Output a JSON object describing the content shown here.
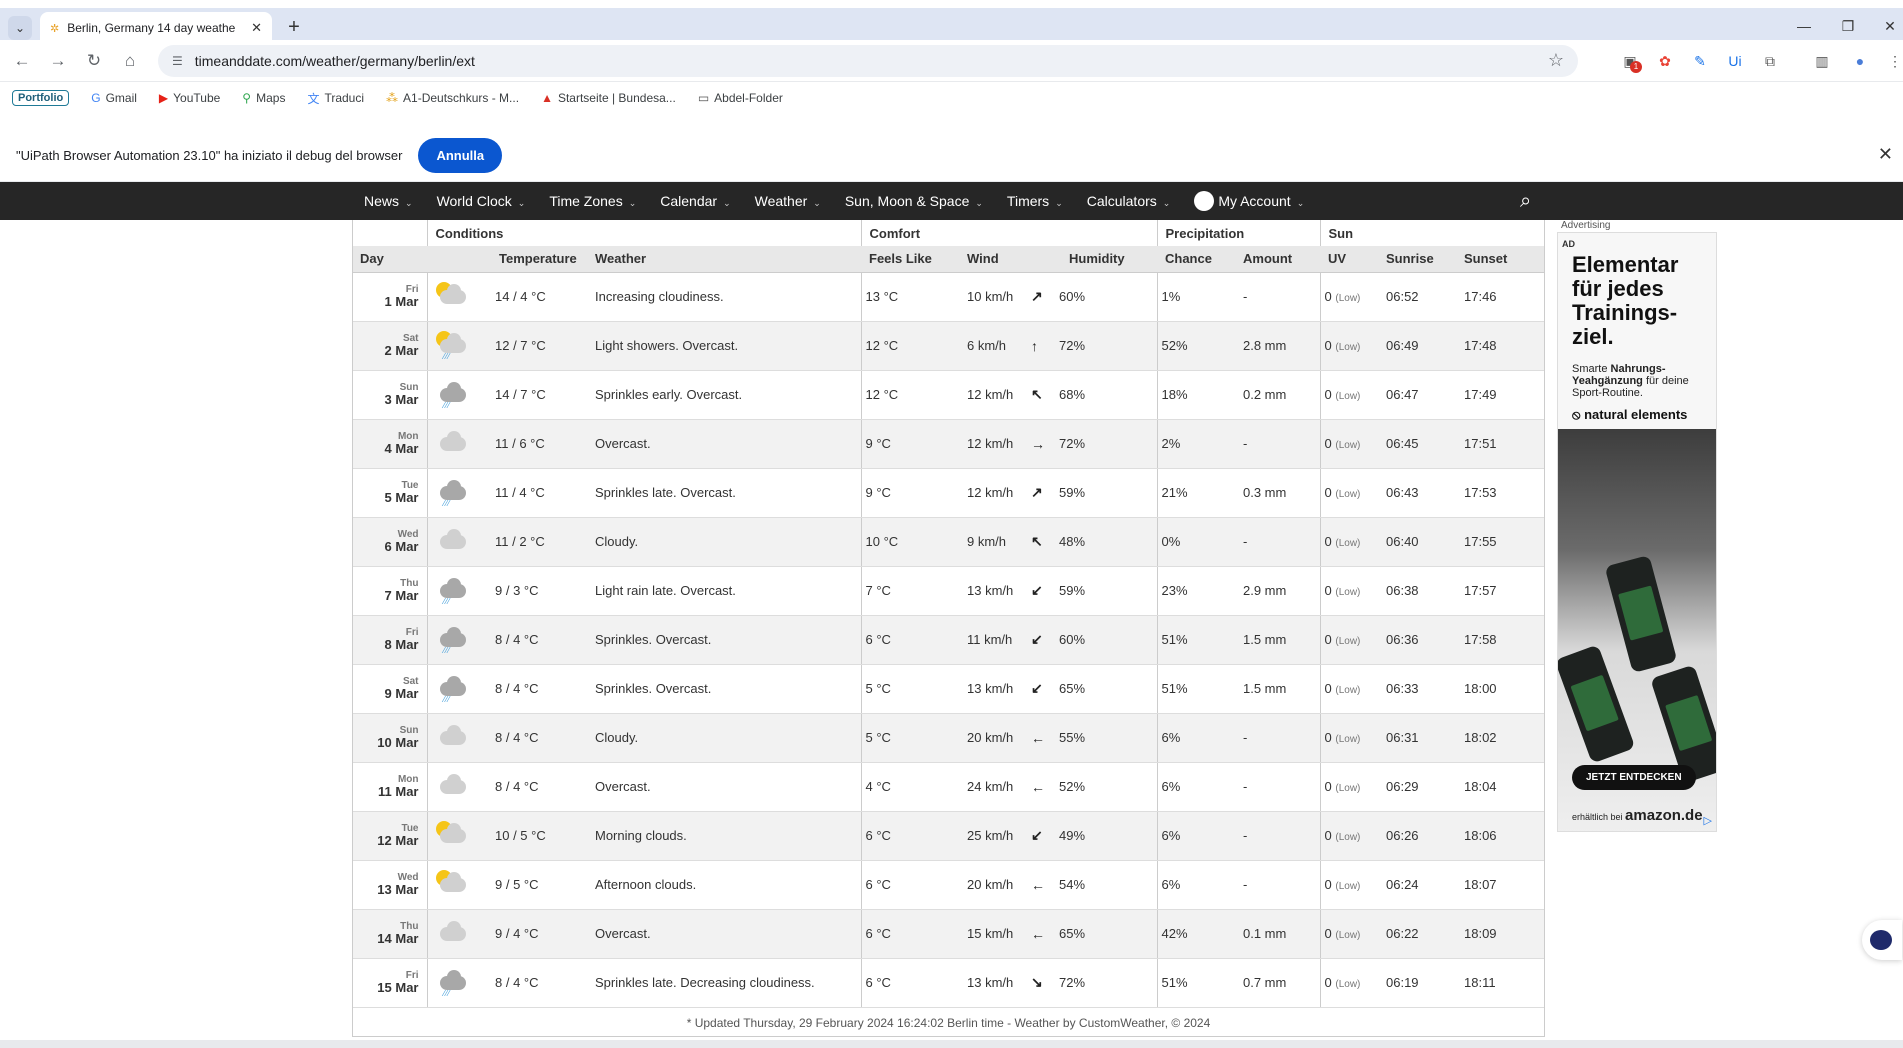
{
  "browser": {
    "tab_title": "Berlin, Germany 14 day weathe",
    "url": "timeanddate.com/weather/germany/berlin/ext",
    "bookmarks": [
      {
        "label": "Portfolio",
        "icon": "portfolio-badge"
      },
      {
        "label": "Gmail",
        "icon": "google-icon"
      },
      {
        "label": "YouTube",
        "icon": "youtube-icon"
      },
      {
        "label": "Maps",
        "icon": "maps-pin-icon"
      },
      {
        "label": "Traduci",
        "icon": "translate-icon"
      },
      {
        "label": "A1-Deutschkurs - M...",
        "icon": "dots-icon"
      },
      {
        "label": "Startseite | Bundesa...",
        "icon": "agency-icon"
      },
      {
        "label": "Abdel-Folder",
        "icon": "folder-icon"
      }
    ],
    "extension_badge": "1"
  },
  "infobar": {
    "message": "\"UiPath Browser Automation 23.10\" ha iniziato il debug del browser",
    "cancel_label": "Annulla"
  },
  "site_nav": {
    "items": [
      "News",
      "World Clock",
      "Time Zones",
      "Calendar",
      "Weather",
      "Sun, Moon & Space",
      "Timers",
      "Calculators"
    ],
    "account_label": "My Account"
  },
  "table": {
    "groups": {
      "conditions": "Conditions",
      "comfort": "Comfort",
      "precipitation": "Precipitation",
      "sun": "Sun"
    },
    "columns": {
      "day": "Day",
      "temperature": "Temperature",
      "weather": "Weather",
      "feels_like": "Feels Like",
      "wind": "Wind",
      "humidity": "Humidity",
      "chance": "Chance",
      "amount": "Amount",
      "uv": "UV",
      "sunrise": "Sunrise",
      "sunset": "Sunset"
    },
    "rows": [
      {
        "dow": "Fri",
        "date": "1 Mar",
        "icon": "sun-cloud",
        "temp": "14 / 4 °C",
        "weather": "Increasing cloudiness.",
        "feels": "13 °C",
        "wind": "10 km/h",
        "dir": "↗",
        "hum": "60%",
        "chance": "1%",
        "amount": "-",
        "uv": "0",
        "uvl": "(Low)",
        "rise": "06:52",
        "set": "17:46"
      },
      {
        "dow": "Sat",
        "date": "2 Mar",
        "icon": "sun-rain",
        "temp": "12 / 7 °C",
        "weather": "Light showers. Overcast.",
        "feels": "12 °C",
        "wind": "6 km/h",
        "dir": "↑",
        "hum": "72%",
        "chance": "52%",
        "amount": "2.8 mm",
        "uv": "0",
        "uvl": "(Low)",
        "rise": "06:49",
        "set": "17:48"
      },
      {
        "dow": "Sun",
        "date": "3 Mar",
        "icon": "rain",
        "temp": "14 / 7 °C",
        "weather": "Sprinkles early. Overcast.",
        "feels": "12 °C",
        "wind": "12 km/h",
        "dir": "↖",
        "hum": "68%",
        "chance": "18%",
        "amount": "0.2 mm",
        "uv": "0",
        "uvl": "(Low)",
        "rise": "06:47",
        "set": "17:49"
      },
      {
        "dow": "Mon",
        "date": "4 Mar",
        "icon": "cloud",
        "temp": "11 / 6 °C",
        "weather": "Overcast.",
        "feels": "9 °C",
        "wind": "12 km/h",
        "dir": "→",
        "hum": "72%",
        "chance": "2%",
        "amount": "-",
        "uv": "0",
        "uvl": "(Low)",
        "rise": "06:45",
        "set": "17:51"
      },
      {
        "dow": "Tue",
        "date": "5 Mar",
        "icon": "rain",
        "temp": "11 / 4 °C",
        "weather": "Sprinkles late. Overcast.",
        "feels": "9 °C",
        "wind": "12 km/h",
        "dir": "↗",
        "hum": "59%",
        "chance": "21%",
        "amount": "0.3 mm",
        "uv": "0",
        "uvl": "(Low)",
        "rise": "06:43",
        "set": "17:53"
      },
      {
        "dow": "Wed",
        "date": "6 Mar",
        "icon": "cloud",
        "temp": "11 / 2 °C",
        "weather": "Cloudy.",
        "feels": "10 °C",
        "wind": "9 km/h",
        "dir": "↖",
        "hum": "48%",
        "chance": "0%",
        "amount": "-",
        "uv": "0",
        "uvl": "(Low)",
        "rise": "06:40",
        "set": "17:55"
      },
      {
        "dow": "Thu",
        "date": "7 Mar",
        "icon": "rain",
        "temp": "9 / 3 °C",
        "weather": "Light rain late. Overcast.",
        "feels": "7 °C",
        "wind": "13 km/h",
        "dir": "↙",
        "hum": "59%",
        "chance": "23%",
        "amount": "2.9 mm",
        "uv": "0",
        "uvl": "(Low)",
        "rise": "06:38",
        "set": "17:57"
      },
      {
        "dow": "Fri",
        "date": "8 Mar",
        "icon": "rain",
        "temp": "8 / 4 °C",
        "weather": "Sprinkles. Overcast.",
        "feels": "6 °C",
        "wind": "11 km/h",
        "dir": "↙",
        "hum": "60%",
        "chance": "51%",
        "amount": "1.5 mm",
        "uv": "0",
        "uvl": "(Low)",
        "rise": "06:36",
        "set": "17:58"
      },
      {
        "dow": "Sat",
        "date": "9 Mar",
        "icon": "rain",
        "temp": "8 / 4 °C",
        "weather": "Sprinkles. Overcast.",
        "feels": "5 °C",
        "wind": "13 km/h",
        "dir": "↙",
        "hum": "65%",
        "chance": "51%",
        "amount": "1.5 mm",
        "uv": "0",
        "uvl": "(Low)",
        "rise": "06:33",
        "set": "18:00"
      },
      {
        "dow": "Sun",
        "date": "10 Mar",
        "icon": "cloud",
        "temp": "8 / 4 °C",
        "weather": "Cloudy.",
        "feels": "5 °C",
        "wind": "20 km/h",
        "dir": "←",
        "hum": "55%",
        "chance": "6%",
        "amount": "-",
        "uv": "0",
        "uvl": "(Low)",
        "rise": "06:31",
        "set": "18:02"
      },
      {
        "dow": "Mon",
        "date": "11 Mar",
        "icon": "cloud",
        "temp": "8 / 4 °C",
        "weather": "Overcast.",
        "feels": "4 °C",
        "wind": "24 km/h",
        "dir": "←",
        "hum": "52%",
        "chance": "6%",
        "amount": "-",
        "uv": "0",
        "uvl": "(Low)",
        "rise": "06:29",
        "set": "18:04"
      },
      {
        "dow": "Tue",
        "date": "12 Mar",
        "icon": "sun-cloud",
        "temp": "10 / 5 °C",
        "weather": "Morning clouds.",
        "feels": "6 °C",
        "wind": "25 km/h",
        "dir": "↙",
        "hum": "49%",
        "chance": "6%",
        "amount": "-",
        "uv": "0",
        "uvl": "(Low)",
        "rise": "06:26",
        "set": "18:06"
      },
      {
        "dow": "Wed",
        "date": "13 Mar",
        "icon": "sun-cloud",
        "temp": "9 / 5 °C",
        "weather": "Afternoon clouds.",
        "feels": "6 °C",
        "wind": "20 km/h",
        "dir": "←",
        "hum": "54%",
        "chance": "6%",
        "amount": "-",
        "uv": "0",
        "uvl": "(Low)",
        "rise": "06:24",
        "set": "18:07"
      },
      {
        "dow": "Thu",
        "date": "14 Mar",
        "icon": "cloud",
        "temp": "9 / 4 °C",
        "weather": "Overcast.",
        "feels": "6 °C",
        "wind": "15 km/h",
        "dir": "←",
        "hum": "65%",
        "chance": "42%",
        "amount": "0.1 mm",
        "uv": "0",
        "uvl": "(Low)",
        "rise": "06:22",
        "set": "18:09"
      },
      {
        "dow": "Fri",
        "date": "15 Mar",
        "icon": "rain",
        "temp": "8 / 4 °C",
        "weather": "Sprinkles late. Decreasing cloudiness.",
        "feels": "6 °C",
        "wind": "13 km/h",
        "dir": "↘",
        "hum": "72%",
        "chance": "51%",
        "amount": "0.7 mm",
        "uv": "0",
        "uvl": "(Low)",
        "rise": "06:19",
        "set": "18:11"
      }
    ],
    "footer": "* Updated Thursday, 29 February 2024 16:24:02 Berlin time - Weather by CustomWeather, © 2024"
  },
  "ad": {
    "label": "Advertising",
    "tag": "AD",
    "headline": "Elementar für jedes Trainings-ziel.",
    "sub_pre": "Smarte ",
    "sub_bold": "Nahrungs-Yeahgänzung",
    "sub_post": " für deine Sport-Routine.",
    "brand": "natural elements",
    "cta": "JETZT ENTDECKEN",
    "amazon_pre": "erhältlich bei",
    "amazon": "amazon.de"
  }
}
